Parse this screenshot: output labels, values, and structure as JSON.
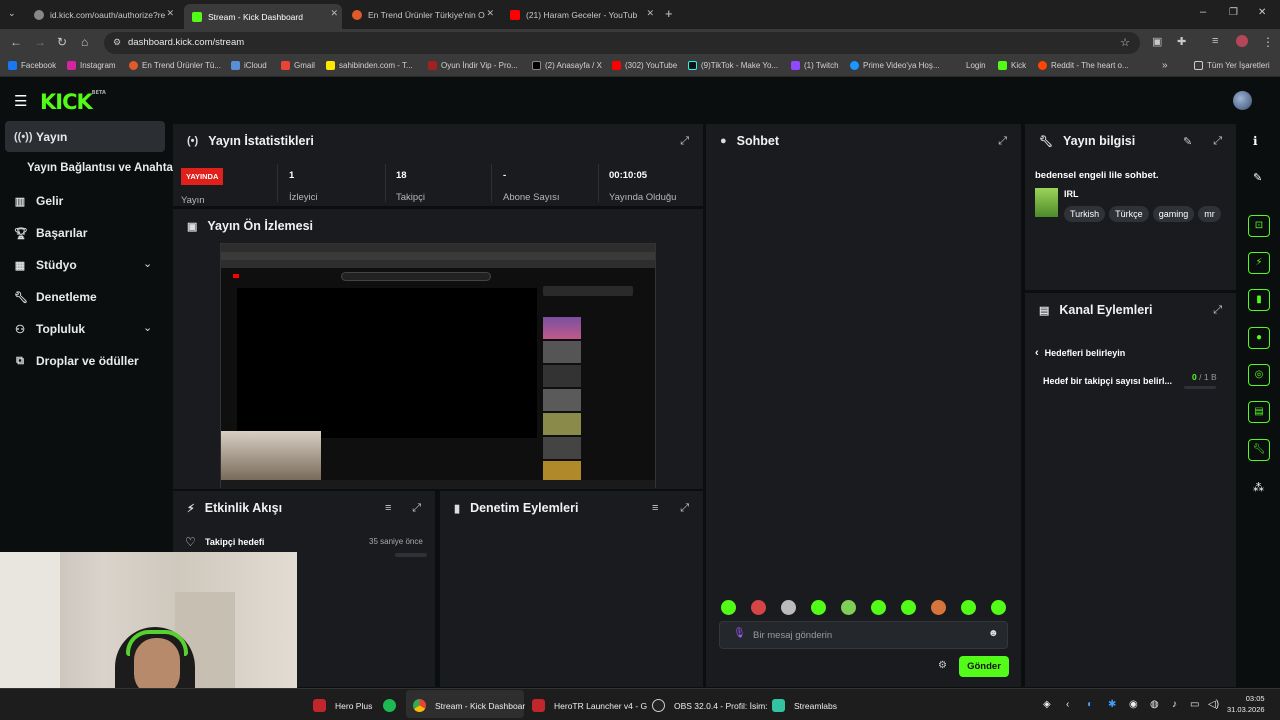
{
  "browser": {
    "tabs": [
      {
        "title": "id.kick.com/oauth/authorize?re",
        "active": false
      },
      {
        "title": "Stream - Kick Dashboard",
        "active": true
      },
      {
        "title": "En Trend Ürünler Türkiye'nin O",
        "active": false
      },
      {
        "title": "(21) Haram Geceler - YouTub",
        "active": false
      }
    ],
    "url": "dashboard.kick.com/stream",
    "bookmarks": [
      "Facebook",
      "Instagram",
      "En Trend Ürünler Tü...",
      "iCloud",
      "Gmail",
      "sahibinden.com - T...",
      "Oyun İndir Vip - Pro...",
      "(2) Anasayfa / X",
      "(302) YouTube",
      "(9)TikTok - Make Yo...",
      "(1) Twitch",
      "Prime Video'ya Hoş...",
      "Login",
      "Kick",
      "Reddit - The heart o..."
    ],
    "all_bookmarks": "Tüm Yer İşaretleri"
  },
  "kick": {
    "logo": "KICK",
    "beta": "BETA"
  },
  "sidebar": {
    "items": [
      {
        "label": "Yayın"
      },
      {
        "label": "Yayın Bağlantısı ve Anahtarı"
      },
      {
        "label": "Gelir"
      },
      {
        "label": "Başarılar"
      },
      {
        "label": "Stüdyo"
      },
      {
        "label": "Denetleme"
      },
      {
        "label": "Topluluk"
      },
      {
        "label": "Droplar ve ödüller"
      }
    ]
  },
  "stats": {
    "title": "Yayın İstatistikleri",
    "live_badge": "YAYINDA",
    "live_label": "Yayın",
    "viewers_value": "1",
    "viewers_label": "İzleyici",
    "followers_value": "18",
    "followers_label": "Takipçi",
    "subs_value": "-",
    "subs_label": "Abone Sayısı",
    "uptime_value": "00:10:05",
    "uptime_label": "Yayında Olduğu"
  },
  "preview": {
    "title": "Yayın Ön İzlemesi"
  },
  "activity": {
    "title": "Etkinlik Akışı",
    "event_label": "Takipçi hedefi",
    "event_time": "35 saniye önce"
  },
  "moderation": {
    "title": "Denetim Eylemleri"
  },
  "chat": {
    "title": "Sohbet",
    "placeholder": "Bir mesaj gönderin",
    "send": "Gönder"
  },
  "stream_info": {
    "title": "Yayın bilgisi",
    "stream_title": "bedensel engeli lile sohbet.",
    "category": "IRL",
    "tags": [
      "Turkish",
      "Türkçe",
      "gaming",
      "mr"
    ]
  },
  "channel_actions": {
    "title": "Kanal Eylemleri",
    "back_label": "Hedefleri belirleyin",
    "goal_label": "Hedef bir takipçi sayısı belirl...",
    "goal_current": "0",
    "goal_sep": "/",
    "goal_target": "1 B"
  },
  "taskbar": {
    "items": [
      "Hero Plus",
      "Stream - Kick Dashboar",
      "HeroTR Launcher v4 - G",
      "OBS 32.0.4 - Profil: İsim:",
      "Streamlabs"
    ],
    "time": "03:05",
    "date": "31.03.2026"
  },
  "colors": {
    "accent": "#53fc18",
    "live": "#e0201b",
    "panel": "#191b1f"
  }
}
